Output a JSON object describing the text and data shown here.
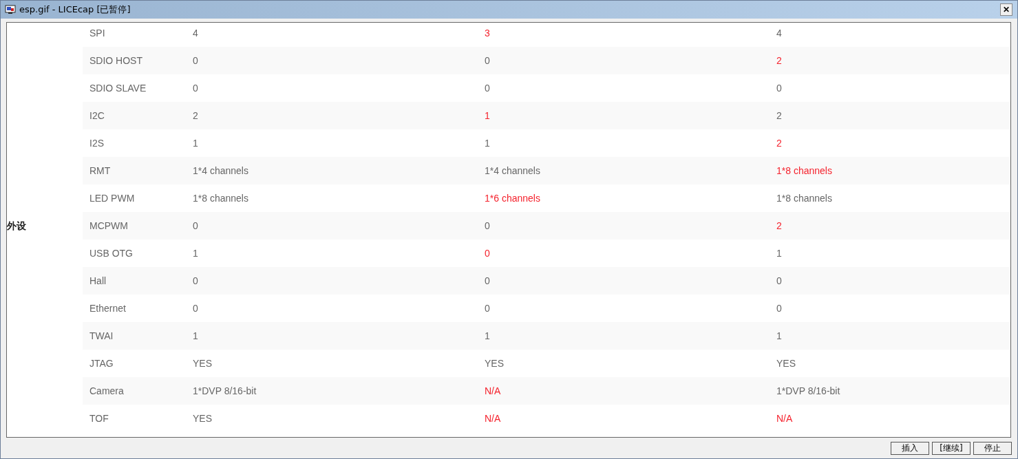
{
  "window": {
    "title": "esp.gif - LICEcap [已暂停]",
    "close": "✕"
  },
  "table": {
    "category": "外设",
    "rows": [
      {
        "name": "SPI",
        "values": [
          {
            "text": "4",
            "highlight": false
          },
          {
            "text": "3",
            "highlight": true
          },
          {
            "text": "4",
            "highlight": false
          }
        ]
      },
      {
        "name": "SDIO HOST",
        "values": [
          {
            "text": "0",
            "highlight": false
          },
          {
            "text": "0",
            "highlight": false
          },
          {
            "text": "2",
            "highlight": true
          }
        ]
      },
      {
        "name": "SDIO SLAVE",
        "values": [
          {
            "text": "0",
            "highlight": false
          },
          {
            "text": "0",
            "highlight": false
          },
          {
            "text": "0",
            "highlight": false
          }
        ]
      },
      {
        "name": "I2C",
        "values": [
          {
            "text": "2",
            "highlight": false
          },
          {
            "text": "1",
            "highlight": true
          },
          {
            "text": "2",
            "highlight": false
          }
        ]
      },
      {
        "name": "I2S",
        "values": [
          {
            "text": "1",
            "highlight": false
          },
          {
            "text": "1",
            "highlight": false
          },
          {
            "text": "2",
            "highlight": true
          }
        ]
      },
      {
        "name": "RMT",
        "values": [
          {
            "text": "1*4 channels",
            "highlight": false
          },
          {
            "text": "1*4 channels",
            "highlight": false
          },
          {
            "text": "1*8 channels",
            "highlight": true
          }
        ]
      },
      {
        "name": "LED PWM",
        "values": [
          {
            "text": "1*8 channels",
            "highlight": false
          },
          {
            "text": "1*6 channels",
            "highlight": true
          },
          {
            "text": "1*8 channels",
            "highlight": false
          }
        ]
      },
      {
        "name": "MCPWM",
        "values": [
          {
            "text": "0",
            "highlight": false
          },
          {
            "text": "0",
            "highlight": false
          },
          {
            "text": "2",
            "highlight": true
          }
        ]
      },
      {
        "name": "USB OTG",
        "values": [
          {
            "text": "1",
            "highlight": false
          },
          {
            "text": "0",
            "highlight": true
          },
          {
            "text": "1",
            "highlight": false
          }
        ]
      },
      {
        "name": "Hall",
        "values": [
          {
            "text": "0",
            "highlight": false
          },
          {
            "text": "0",
            "highlight": false
          },
          {
            "text": "0",
            "highlight": false
          }
        ]
      },
      {
        "name": "Ethernet",
        "values": [
          {
            "text": "0",
            "highlight": false
          },
          {
            "text": "0",
            "highlight": false
          },
          {
            "text": "0",
            "highlight": false
          }
        ]
      },
      {
        "name": "TWAI",
        "values": [
          {
            "text": "1",
            "highlight": false
          },
          {
            "text": "1",
            "highlight": false
          },
          {
            "text": "1",
            "highlight": false
          }
        ]
      },
      {
        "name": "JTAG",
        "values": [
          {
            "text": "YES",
            "highlight": false
          },
          {
            "text": "YES",
            "highlight": false
          },
          {
            "text": "YES",
            "highlight": false
          }
        ]
      },
      {
        "name": "Camera",
        "values": [
          {
            "text": "1*DVP 8/16-bit",
            "highlight": false
          },
          {
            "text": "N/A",
            "highlight": true
          },
          {
            "text": "1*DVP 8/16-bit",
            "highlight": false
          }
        ]
      },
      {
        "name": "TOF",
        "values": [
          {
            "text": "YES",
            "highlight": false
          },
          {
            "text": "N/A",
            "highlight": true
          },
          {
            "text": "N/A",
            "highlight": true
          }
        ]
      }
    ]
  },
  "buttons": [
    {
      "label": "插入"
    },
    {
      "label": "[继续]"
    },
    {
      "label": "停止"
    }
  ]
}
